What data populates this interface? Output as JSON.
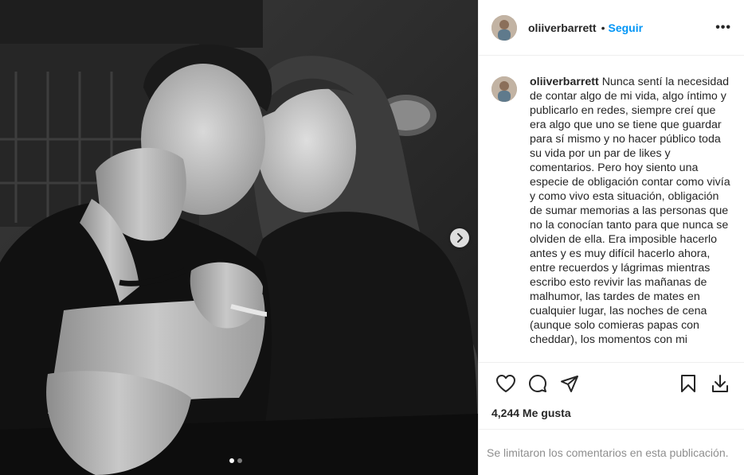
{
  "post": {
    "username": "oliiverbarrett",
    "separator": "•",
    "follow_label": "Seguir",
    "more_options": "•••",
    "caption": "Nunca sentí la necesidad de contar algo de mi vida, algo íntimo y publicarlo en redes, siempre creí que era algo que uno se tiene que guardar para sí mismo y no hacer público toda su vida por un par de likes y comentarios. Pero hoy siento una especie de obligación contar como vivía y como vivo esta situación, obligación de sumar memorias a las personas que no la conocían tanto para que nunca se olviden de ella. Era imposible hacerlo antes y es muy difícil hacerlo ahora, entre recuerdos y lágrimas  mientras escribo esto revivir las mañanas de malhumor, las tardes de mates en cualquier lugar, las noches de cena (aunque solo comieras papas con cheddar), los momentos con mi",
    "likes": "4,244 Me gusta",
    "comments_notice": "Se limitaron los comentarios en esta publicación.",
    "carousel": {
      "total": 2,
      "current": 1
    }
  },
  "icons": {
    "like": "heart-icon",
    "comment": "comment-icon",
    "share": "paper-plane-icon",
    "save": "bookmark-icon",
    "download": "download-icon",
    "next": "chevron-right-icon"
  },
  "colors": {
    "accent": "#0095f6",
    "text": "#262626",
    "muted": "#8e8e8e",
    "border": "#efefef"
  }
}
